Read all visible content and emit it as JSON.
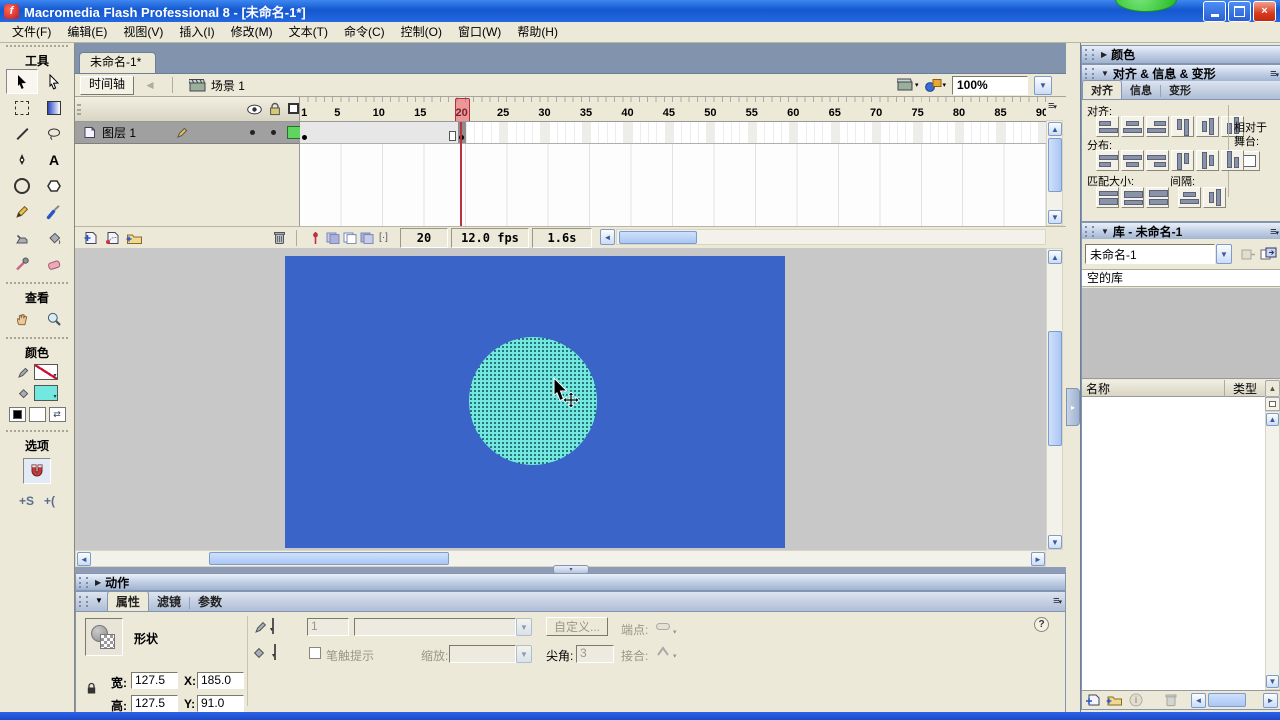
{
  "window": {
    "title": "Macromedia Flash Professional 8 - [未命名-1*]",
    "close_glyph": "×"
  },
  "menu": {
    "items": [
      "文件(F)",
      "编辑(E)",
      "视图(V)",
      "插入(I)",
      "修改(M)",
      "文本(T)",
      "命令(C)",
      "控制(O)",
      "窗口(W)",
      "帮助(H)"
    ]
  },
  "toolbar": {
    "tools_label": "工具",
    "view_label": "查看",
    "colors_label": "颜色",
    "options_label": "选项",
    "smooth_glyph": "+S",
    "straighten_glyph": "+("
  },
  "document": {
    "tab": "未命名-1*",
    "timeline_button": "时间轴",
    "scene_label": "场景 1",
    "zoom_value": "100%"
  },
  "timeline": {
    "layer_name": "图层 1",
    "ruler_numbers": [
      "1",
      "5",
      "10",
      "15",
      "20",
      "25",
      "30",
      "35",
      "40",
      "45",
      "50",
      "55",
      "60",
      "65",
      "70",
      "75",
      "80",
      "85",
      "90"
    ],
    "total_frames": 90,
    "span_end": 19,
    "playhead_frame": 20,
    "current_frame": "20",
    "frame_rate": "12.0 fps",
    "elapsed_time": "1.6s"
  },
  "stage": {
    "background_color": "#3B64C8",
    "workspace_color": "#C8C8C8",
    "shape_fill_color": "#72E8E1"
  },
  "panels": {
    "color": {
      "title": "颜色"
    },
    "align": {
      "title": "对齐 & 信息 & 变形",
      "tabs": [
        "对齐",
        "信息",
        "变形"
      ],
      "align_label": "对齐:",
      "distribute_label": "分布:",
      "match_label": "匹配大小:",
      "space_label": "间隔:",
      "relative_line1": "相对于",
      "relative_line2": "舞台:"
    },
    "library": {
      "title": "库 - 未命名-1",
      "document_select": "未命名-1",
      "empty_text": "空的库",
      "col_name": "名称",
      "col_type": "类型"
    },
    "actions": {
      "title": "动作"
    },
    "properties": {
      "tabs": [
        "属性",
        "滤镜",
        "参数"
      ],
      "shape_type": "形状",
      "stroke_width": "1",
      "custom_button": "自定义...",
      "cap_label": "端点:",
      "hint_label": "笔触提示",
      "scale_label": "缩放:",
      "miter_label": "尖角:",
      "miter_value": "3",
      "join_label": "接合:",
      "help_glyph": "?",
      "width_label": "宽:",
      "width_value": "127.5",
      "height_label": "高:",
      "height_value": "127.5",
      "x_label": "X:",
      "x_value": "185.0",
      "y_label": "Y:",
      "y_value": "91.0"
    }
  }
}
